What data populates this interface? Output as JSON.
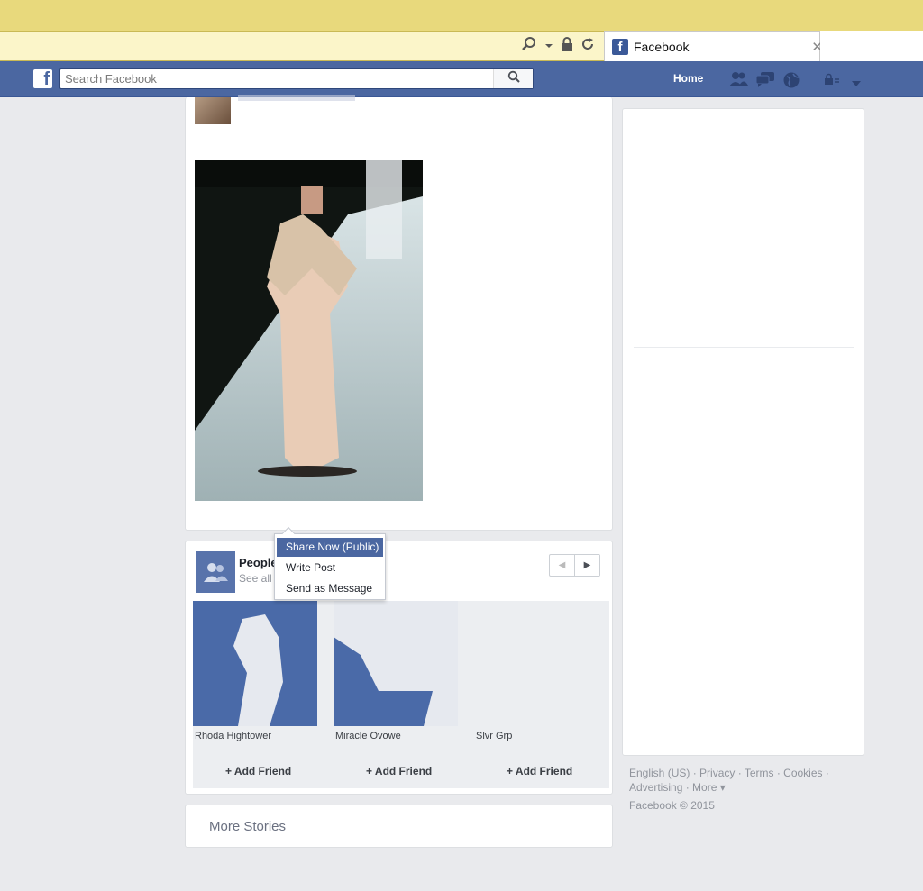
{
  "browser": {
    "tab_title": "Facebook",
    "tab_close": "✕"
  },
  "header": {
    "logo": "f",
    "search_placeholder": "Search Facebook",
    "home_label": "Home"
  },
  "share_menu": {
    "items": [
      "Share Now (Public)",
      "Write Post",
      "Send as Message"
    ],
    "selected_index": 0
  },
  "people": {
    "title": "People",
    "subtitle": "See all",
    "suggestions": [
      {
        "name": "Rhoda Hightower",
        "action": "+ Add Friend"
      },
      {
        "name": "Miracle Ovowe",
        "action": "+ Add Friend"
      },
      {
        "name": "Slvr Grp",
        "action": "+ Add Friend"
      }
    ]
  },
  "more_stories": "More Stories",
  "footer": {
    "links": [
      "English (US)",
      "Privacy",
      "Terms",
      "Cookies",
      "Advertising",
      "More"
    ],
    "copyright": "Facebook © 2015"
  },
  "colors": {
    "brand": "#4b67a1",
    "chrome": "#e8d97c"
  },
  "icons": [
    "search-icon",
    "dropdown-arrow-icon",
    "lock-icon",
    "refresh-icon",
    "friends-icon",
    "messages-icon",
    "globe-icon",
    "privacy-icon",
    "chevron-down-icon",
    "people-icon"
  ]
}
